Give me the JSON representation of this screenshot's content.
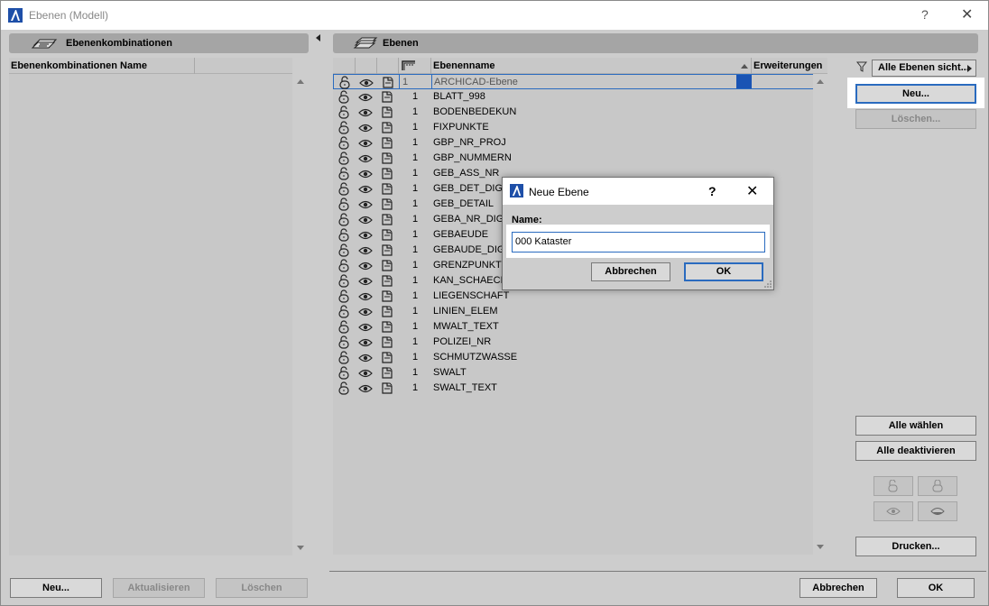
{
  "window": {
    "title": "Ebenen (Modell)",
    "help": "?",
    "close": "✕"
  },
  "left_panel": {
    "header": "Ebenenkombinationen",
    "column": "Ebenenkombinationen Name",
    "buttons": {
      "new": "Neu...",
      "update": "Aktualisieren",
      "delete": "Löschen"
    }
  },
  "right_panel": {
    "header": "Ebenen",
    "columns": {
      "name": "Ebenenname",
      "extensions": "Erweiterungen"
    },
    "layers": [
      {
        "num": "1",
        "name": "ARCHICAD-Ebene",
        "selected": true
      },
      {
        "num": "1",
        "name": "BLATT_998"
      },
      {
        "num": "1",
        "name": "BODENBEDEKUN"
      },
      {
        "num": "1",
        "name": "FIXPUNKTE"
      },
      {
        "num": "1",
        "name": "GBP_NR_PROJ"
      },
      {
        "num": "1",
        "name": "GBP_NUMMERN"
      },
      {
        "num": "1",
        "name": "GEB_ASS_NR"
      },
      {
        "num": "1",
        "name": "GEB_DET_DIG"
      },
      {
        "num": "1",
        "name": "GEB_DETAIL"
      },
      {
        "num": "1",
        "name": "GEBA_NR_DIG"
      },
      {
        "num": "1",
        "name": "GEBAEUDE"
      },
      {
        "num": "1",
        "name": "GEBAUDE_DIGI"
      },
      {
        "num": "1",
        "name": "GRENZPUNKTE"
      },
      {
        "num": "1",
        "name": "KAN_SCHAECHT"
      },
      {
        "num": "1",
        "name": "LIEGENSCHAFT"
      },
      {
        "num": "1",
        "name": "LINIEN_ELEM"
      },
      {
        "num": "1",
        "name": "MWALT_TEXT"
      },
      {
        "num": "1",
        "name": "POLIZEI_NR"
      },
      {
        "num": "1",
        "name": "SCHMUTZWASSE"
      },
      {
        "num": "1",
        "name": "SWALT"
      },
      {
        "num": "1",
        "name": "SWALT_TEXT"
      }
    ]
  },
  "sidebar": {
    "filter": "Alle Ebenen sicht...",
    "new": "Neu...",
    "delete": "Löschen...",
    "select_all": "Alle wählen",
    "deactivate_all": "Alle deaktivieren",
    "print": "Drucken..."
  },
  "footer": {
    "cancel": "Abbrechen",
    "ok": "OK"
  },
  "dialog": {
    "title": "Neue Ebene",
    "help": "?",
    "close": "✕",
    "name_label": "Name:",
    "name_value": "000 Kataster",
    "cancel": "Abbrechen",
    "ok": "OK"
  },
  "colors": {
    "selection_blue": "#1a54b4",
    "focus_border": "#2a6bbf"
  }
}
